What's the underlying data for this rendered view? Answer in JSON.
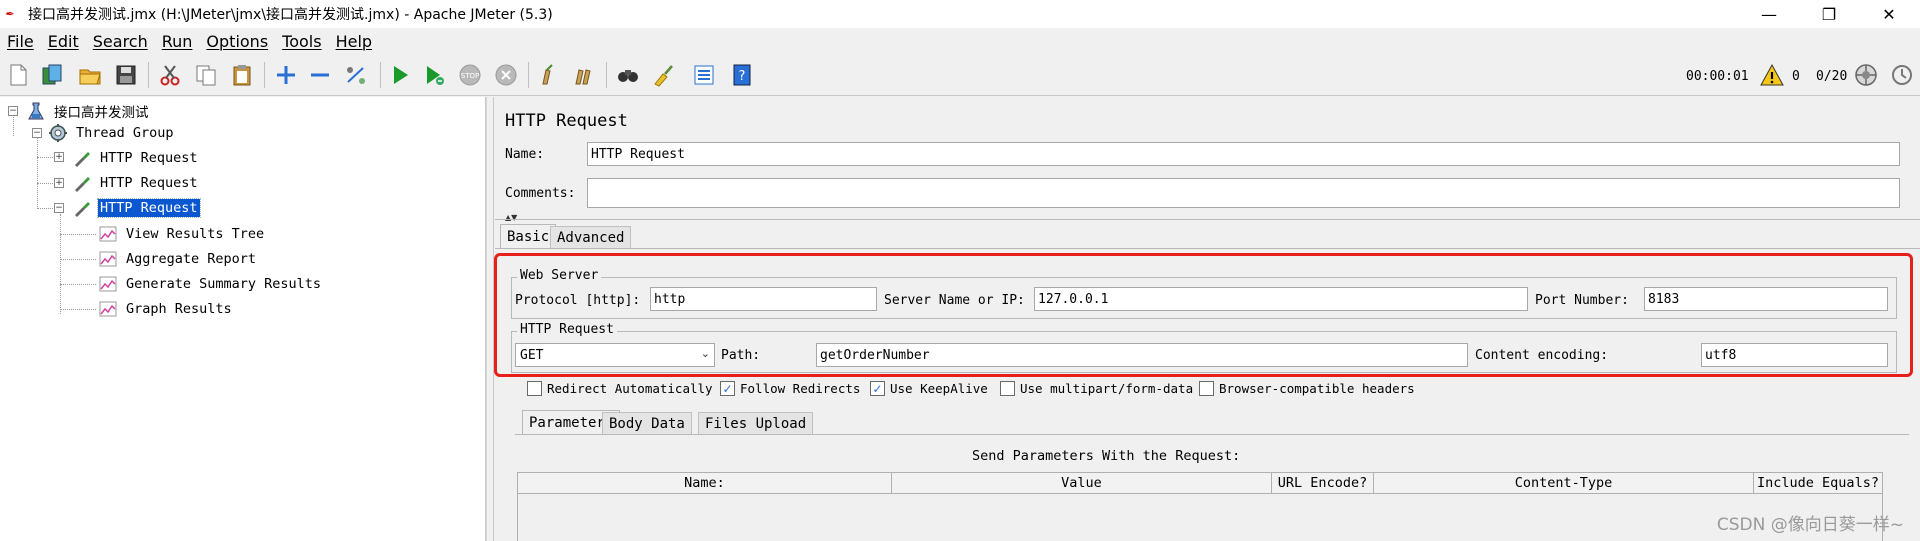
{
  "window": {
    "title": "接口高并发测试.jmx (H:\\JMeter\\jmx\\接口高并发测试.jmx) - Apache JMeter (5.3)",
    "minimize": "—",
    "maximize": "❐",
    "close": "✕"
  },
  "menu": [
    "File",
    "Edit",
    "Search",
    "Run",
    "Options",
    "Tools",
    "Help"
  ],
  "toolbar": {
    "icons": [
      "new-icon",
      "templates-icon",
      "open-icon",
      "save-icon",
      "cut-icon",
      "copy-icon",
      "paste-icon",
      "expand-icon",
      "collapse-icon",
      "toggle-icon",
      "start-icon",
      "start-no-pause-icon",
      "stop-icon",
      "shutdown-icon",
      "clear-icon",
      "clear-all-icon",
      "search-icon",
      "reset-search-icon",
      "function-helper-icon",
      "help-icon"
    ],
    "elapsed_time": "00:00:01",
    "warning_count": "0",
    "threads": "0/20"
  },
  "tree": {
    "root": "接口高并发测试",
    "thread_group": "Thread Group",
    "requests": [
      "HTTP Request",
      "HTTP Request",
      "HTTP Request"
    ],
    "listeners": [
      "View Results Tree",
      "Aggregate Report",
      "Generate Summary Results",
      "Graph Results"
    ]
  },
  "panel": {
    "title": "HTTP Request",
    "name_label": "Name:",
    "name_value": "HTTP Request",
    "comments_label": "Comments:",
    "comments_value": "",
    "tabs": [
      "Basic",
      "Advanced"
    ],
    "web_server": {
      "title": "Web Server",
      "protocol_label": "Protocol [http]:",
      "protocol_value": "http",
      "server_label": "Server Name or IP:",
      "server_value": "127.0.0.1",
      "port_label": "Port Number:",
      "port_value": "8183"
    },
    "http_request": {
      "title": "HTTP Request",
      "method": "GET",
      "path_label": "Path:",
      "path_value": "getOrderNumber",
      "encoding_label": "Content encoding:",
      "encoding_value": "utf8"
    },
    "checkboxes": [
      {
        "label": "Redirect Automatically",
        "checked": false
      },
      {
        "label": "Follow Redirects",
        "checked": true
      },
      {
        "label": "Use KeepAlive",
        "checked": true
      },
      {
        "label": "Use multipart/form-data",
        "checked": false
      },
      {
        "label": "Browser-compatible headers",
        "checked": false
      }
    ],
    "sub_tabs": [
      "Parameters",
      "Body Data",
      "Files Upload"
    ],
    "params_caption": "Send Parameters With the Request:",
    "columns": [
      "Name:",
      "Value",
      "URL Encode?",
      "Content-Type",
      "Include Equals?"
    ]
  },
  "watermark": "CSDN @像向日葵一样~",
  "colors": {
    "selection": "#0b57d0",
    "highlight_border": "#e8201a"
  }
}
